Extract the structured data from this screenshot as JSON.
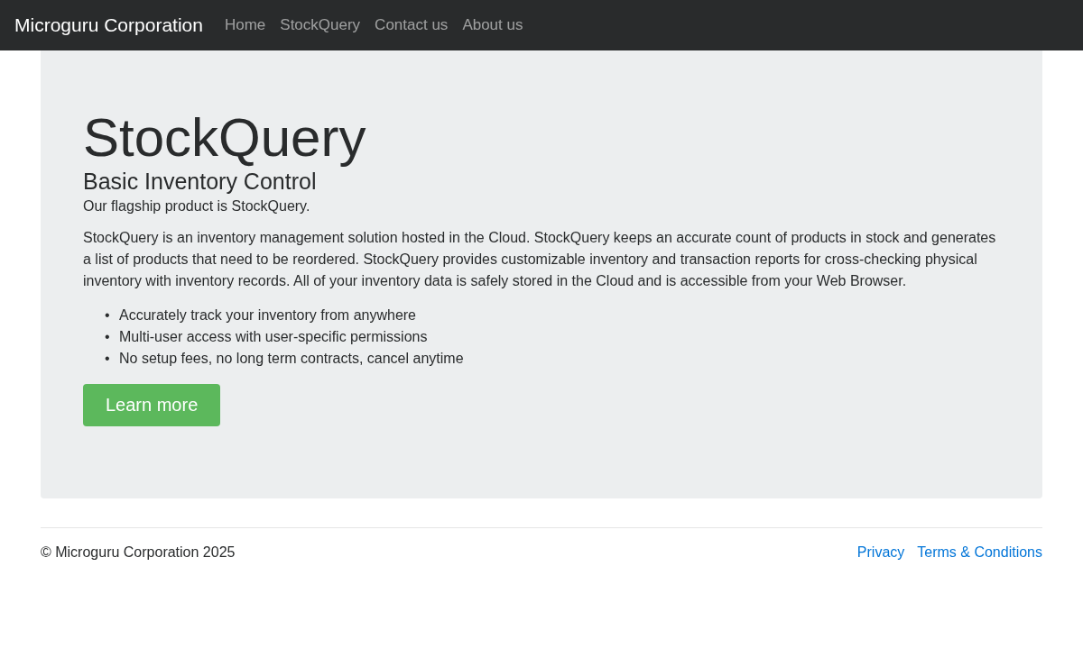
{
  "navbar": {
    "brand": "Microguru Corporation",
    "links": [
      "Home",
      "StockQuery",
      "Contact us",
      "About us"
    ]
  },
  "hero": {
    "title": "StockQuery",
    "subtitle": "Basic Inventory Control",
    "lead": "Our flagship product is StockQuery.",
    "paragraph": "StockQuery is an inventory management solution hosted in the Cloud. StockQuery keeps an accurate count of products in stock and generates a list of products that need to be reordered. StockQuery provides customizable inventory and transaction reports for cross-checking physical inventory with inventory records. All of your inventory data is safely stored in the Cloud and is accessible from your Web Browser.",
    "features": [
      {
        "bullet": "•",
        "text": "Accurately track your inventory from anywhere"
      },
      {
        "bullet": "•",
        "text": "Multi-user access with user-specific permissions"
      },
      {
        "bullet": "•",
        "text": "No setup fees, no long term contracts, cancel anytime"
      }
    ],
    "button": "Learn more"
  },
  "footer": {
    "copyright": "© Microguru Corporation 2025",
    "links": [
      "Privacy",
      "Terms & Conditions"
    ]
  }
}
